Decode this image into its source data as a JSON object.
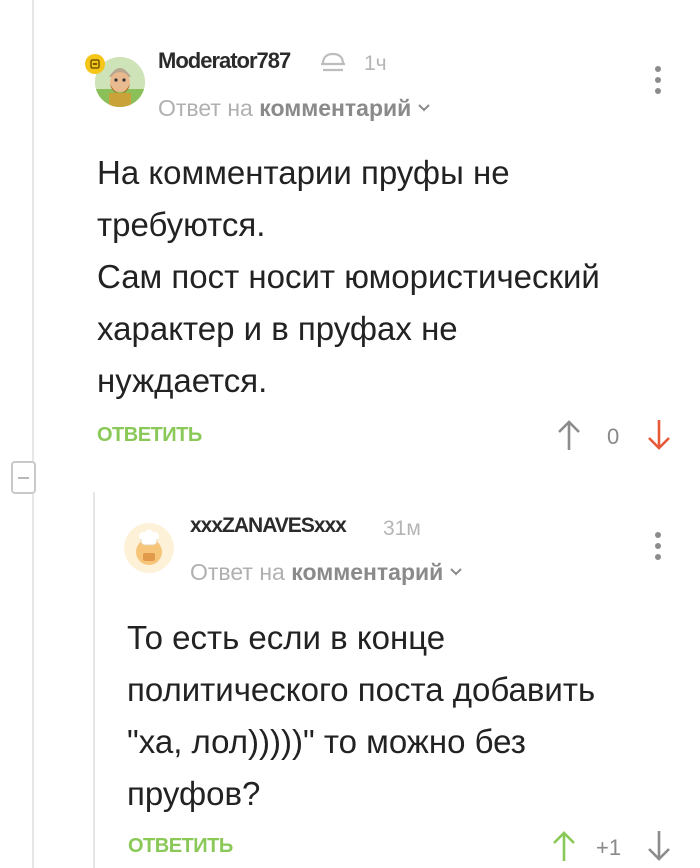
{
  "comments": [
    {
      "username": "Moderator787",
      "time": "1ч",
      "reply_prefix": "Ответ на",
      "reply_target": "комментарий",
      "text": "На комментарии пруфы не\nтребуются.\nСам пост носит юмористический\nхарактер и в пруфах не\nнуждается.",
      "reply_label": "ОТВЕТИТЬ",
      "rating": "0"
    },
    {
      "username": "xxxZANAVESxxx",
      "time": "31м",
      "reply_prefix": "Ответ на",
      "reply_target": "комментарий",
      "text": "То есть если в конце\nполитического поста добавить\n\"ха, лол)))))\" то можно без\nпруфов?",
      "reply_label": "ОТВЕТИТЬ",
      "rating": "+1"
    }
  ],
  "colors": {
    "accent_green": "#8ac858",
    "downvote_red": "#e8593a",
    "muted_gray": "#8c8c8c"
  },
  "icons": {
    "moderator_badge": "moderator-shield-icon",
    "upvote": "arrow-up-icon",
    "downvote": "arrow-down-icon",
    "menu": "kebab-menu-icon",
    "collapse": "collapse-minus-icon"
  }
}
